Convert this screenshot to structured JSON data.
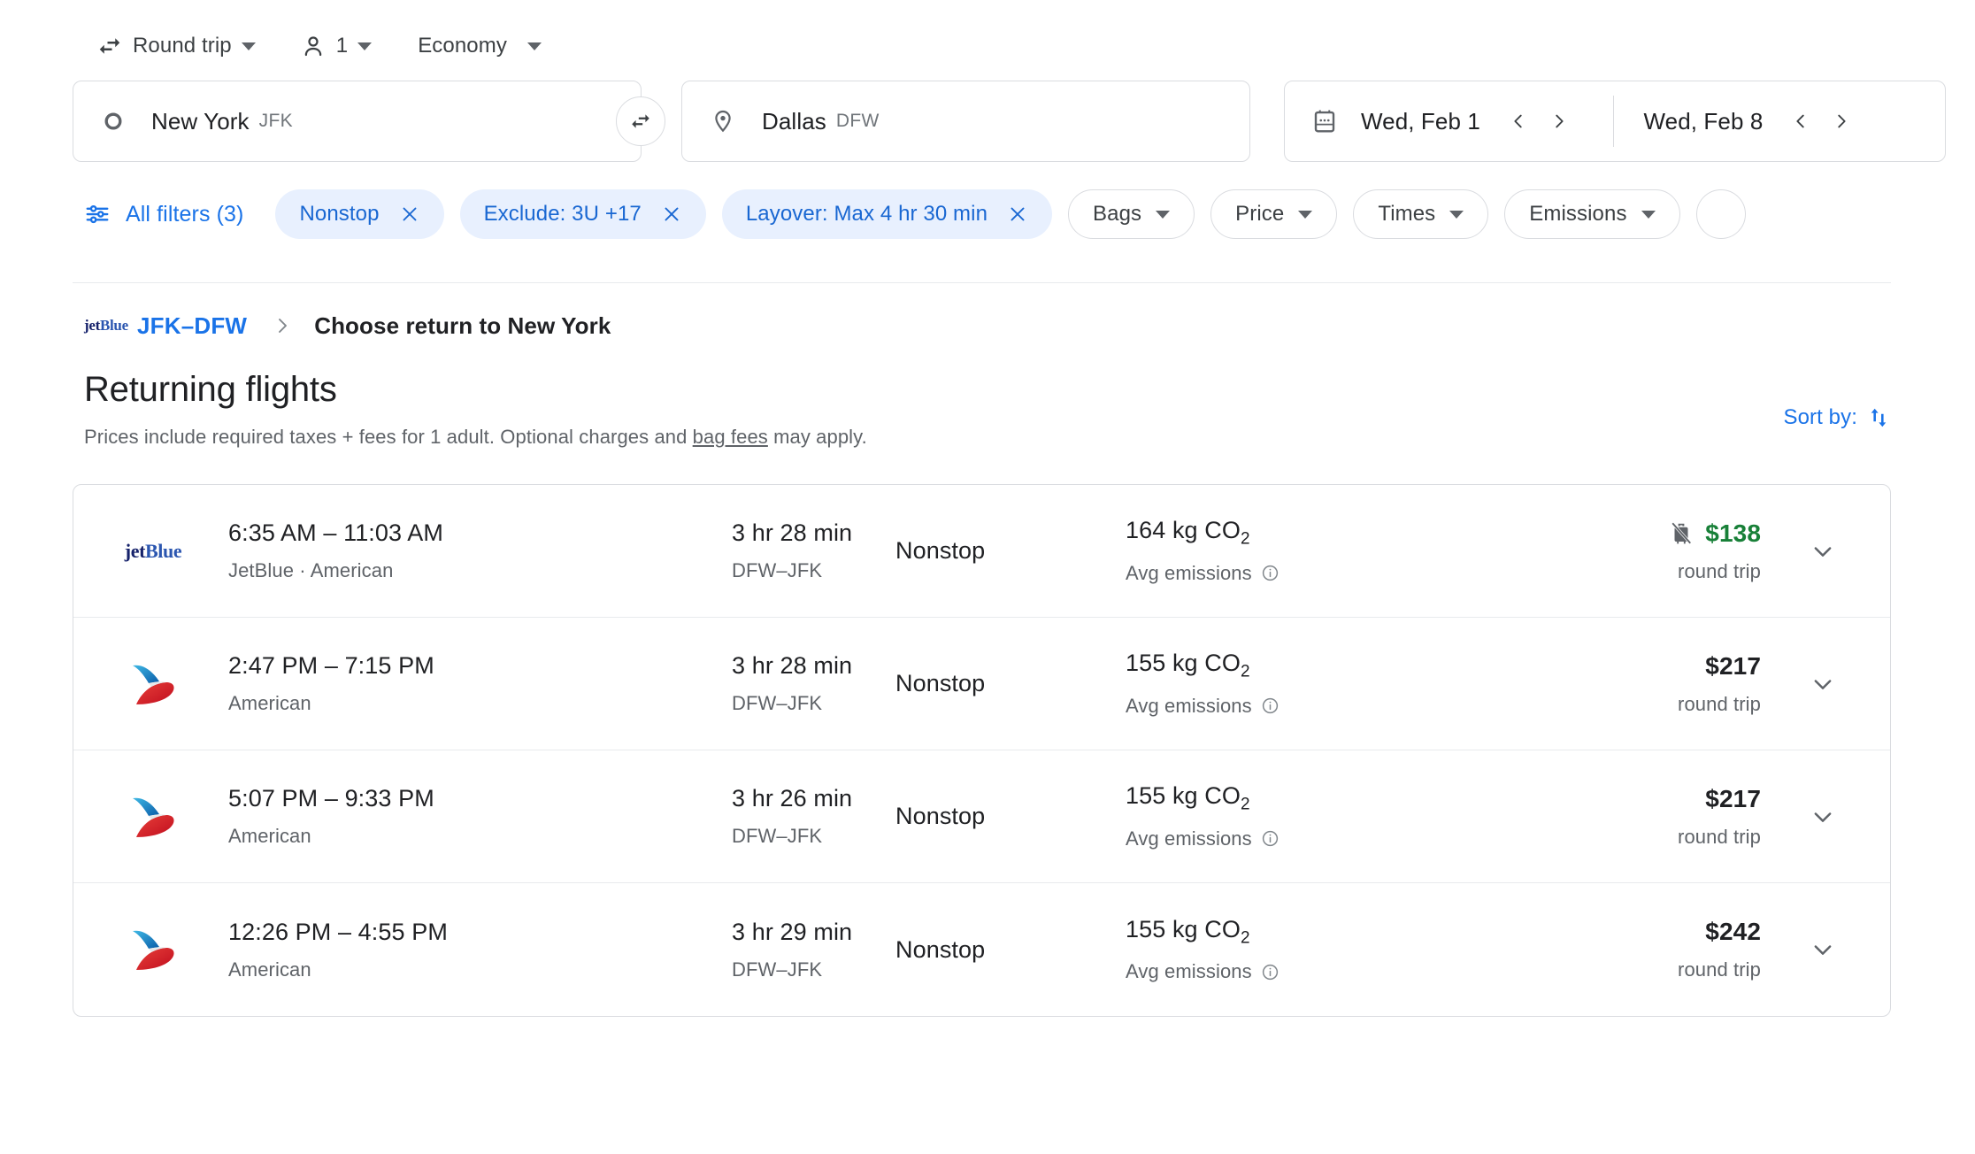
{
  "trip_options": {
    "trip_type": {
      "label": "Round trip",
      "icon": "swap-horizontal-icon"
    },
    "passengers": {
      "label": "1",
      "icon": "person-icon"
    },
    "cabin_class": {
      "label": "Economy"
    }
  },
  "search": {
    "origin": {
      "city": "New York",
      "code": "JFK",
      "icon": "circle-outline-icon"
    },
    "destination": {
      "city": "Dallas",
      "code": "DFW",
      "icon": "map-pin-icon"
    },
    "swap_icon": "swap-arrows-icon",
    "depart_date": "Wed, Feb 1",
    "return_date": "Wed, Feb 8",
    "calendar_icon": "calendar-icon",
    "prev_icon": "chevron-left-icon",
    "next_icon": "chevron-right-icon"
  },
  "filters": {
    "all_filters_label": "All filters (3)",
    "all_filters_icon": "tune-sliders-icon",
    "active_chips": [
      {
        "label": "Nonstop",
        "removable": true
      },
      {
        "label": "Exclude: 3U +17",
        "removable": true
      },
      {
        "label": "Layover: Max 4 hr 30 min",
        "removable": true
      }
    ],
    "dropdown_chips": [
      {
        "label": "Bags"
      },
      {
        "label": "Price"
      },
      {
        "label": "Times"
      },
      {
        "label": "Emissions"
      }
    ]
  },
  "breadcrumb": {
    "airline_logo": "jetblue-logo",
    "airline_logo_part1": "jet",
    "airline_logo_part2": "Blue",
    "leg_link": "JFK–DFW",
    "separator_icon": "chevron-right-icon",
    "current": "Choose return to New York"
  },
  "heading": {
    "title": "Returning flights",
    "subtitle_before": "Prices include required taxes + fees for 1 adult. Optional charges and ",
    "subtitle_link": "bag fees",
    "subtitle_after": " may apply.",
    "sort_by_label": "Sort by:",
    "sort_icon": "sort-arrows-icon"
  },
  "flights": [
    {
      "airline_logo": "jetblue-logo",
      "logo_part1": "jet",
      "logo_part2": "Blue",
      "times": "6:35 AM – 11:03 AM",
      "operator": "JetBlue · American",
      "duration": "3 hr 28 min",
      "route": "DFW–JFK",
      "stops": "Nonstop",
      "emissions": "164 kg CO",
      "emissions_sub": "2",
      "emissions_note": "Avg emissions",
      "info_icon": "info-circle-icon",
      "no_bag_icon": "no-carry-on-bag-icon",
      "has_no_bag_icon": true,
      "price": "$138",
      "price_is_deal": true,
      "price_note": "round trip",
      "expand_icon": "chevron-down-icon"
    },
    {
      "airline_logo": "american-airlines-logo",
      "times": "2:47 PM – 7:15 PM",
      "operator": "American",
      "duration": "3 hr 28 min",
      "route": "DFW–JFK",
      "stops": "Nonstop",
      "emissions": "155 kg CO",
      "emissions_sub": "2",
      "emissions_note": "Avg emissions",
      "info_icon": "info-circle-icon",
      "has_no_bag_icon": false,
      "price": "$217",
      "price_is_deal": false,
      "price_note": "round trip",
      "expand_icon": "chevron-down-icon"
    },
    {
      "airline_logo": "american-airlines-logo",
      "times": "5:07 PM – 9:33 PM",
      "operator": "American",
      "duration": "3 hr 26 min",
      "route": "DFW–JFK",
      "stops": "Nonstop",
      "emissions": "155 kg CO",
      "emissions_sub": "2",
      "emissions_note": "Avg emissions",
      "info_icon": "info-circle-icon",
      "has_no_bag_icon": false,
      "price": "$217",
      "price_is_deal": false,
      "price_note": "round trip",
      "expand_icon": "chevron-down-icon"
    },
    {
      "airline_logo": "american-airlines-logo",
      "times": "12:26 PM – 4:55 PM",
      "operator": "American",
      "duration": "3 hr 29 min",
      "route": "DFW–JFK",
      "stops": "Nonstop",
      "emissions": "155 kg CO",
      "emissions_sub": "2",
      "emissions_note": "Avg emissions",
      "info_icon": "info-circle-icon",
      "has_no_bag_icon": false,
      "price": "$242",
      "price_is_deal": false,
      "price_note": "round trip",
      "expand_icon": "chevron-down-icon"
    }
  ],
  "colors": {
    "accent_blue": "#1a73e8",
    "chip_active_bg": "#e8f0fe",
    "chip_active_text": "#1967d2",
    "deal_green": "#188038",
    "text_primary": "#202124",
    "text_secondary": "#5f6368",
    "border": "#dadce0"
  }
}
